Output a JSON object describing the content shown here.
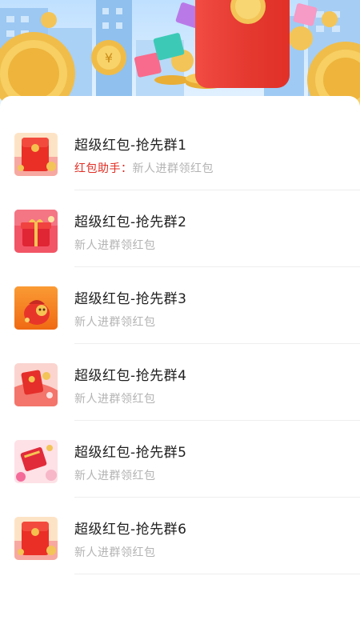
{
  "groups": [
    {
      "title": "超级红包-抢先群1",
      "tag": "红包助手：",
      "subtitle": "新人进群领红包"
    },
    {
      "title": "超级红包-抢先群2",
      "subtitle": "新人进群领红包"
    },
    {
      "title": "超级红包-抢先群3",
      "subtitle": "新人进群领红包"
    },
    {
      "title": "超级红包-抢先群4",
      "subtitle": "新人进群领红包"
    },
    {
      "title": "超级红包-抢先群5",
      "subtitle": "新人进群领红包"
    },
    {
      "title": "超级红包-抢先群6",
      "subtitle": "新人进群领红包"
    }
  ],
  "colors": {
    "accent": "#e02e24",
    "title": "#1f1f1f",
    "subtitle": "#b3b3b3"
  }
}
